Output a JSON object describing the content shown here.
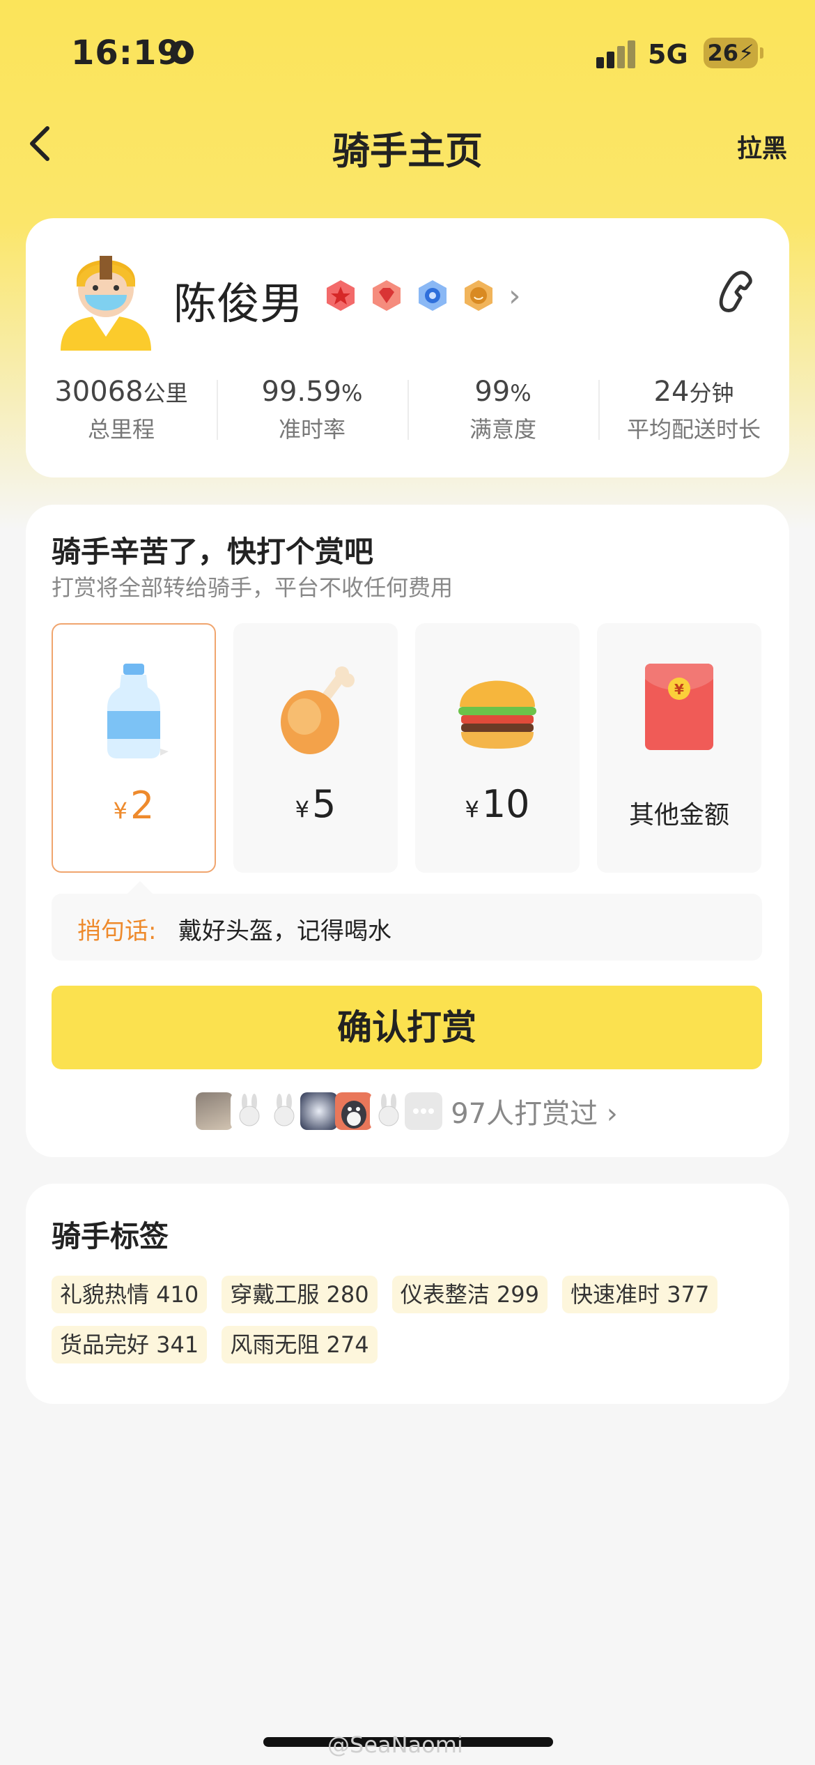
{
  "status_bar": {
    "time": "16:19",
    "network": "5G",
    "battery": "26"
  },
  "nav": {
    "title": "骑手主页",
    "block_label": "拉黑"
  },
  "rider": {
    "name": "陈俊男",
    "medals": [
      "red-star-medal-icon",
      "red-diamond-medal-icon",
      "blue-medal-icon",
      "gold-smile-medal-icon"
    ],
    "stats": [
      {
        "value": "30068",
        "unit": "公里",
        "label": "总里程"
      },
      {
        "value": "99.59",
        "unit": "%",
        "label": "准时率"
      },
      {
        "value": "99",
        "unit": "%",
        "label": "满意度"
      },
      {
        "value": "24",
        "unit": "分钟",
        "label": "平均配送时长"
      }
    ]
  },
  "tip": {
    "title": "骑手辛苦了，快打个赏吧",
    "subtitle": "打赏将全部转给骑手，平台不收任何费用",
    "currency": "¥",
    "options": [
      {
        "icon": "water-bottle-icon",
        "amount": "2",
        "selected": true
      },
      {
        "icon": "chicken-leg-icon",
        "amount": "5",
        "selected": false
      },
      {
        "icon": "burger-icon",
        "amount": "10",
        "selected": false
      },
      {
        "icon": "red-envelope-icon",
        "text": "其他金额",
        "selected": false
      }
    ],
    "message_label": "捎句话:",
    "message_text": "戴好头盔，记得喝水",
    "confirm_label": "确认打赏",
    "tippers_count": "97人打赏过 ›"
  },
  "tags": {
    "title": "骑手标签",
    "items": [
      "礼貌热情 410",
      "穿戴工服 280",
      "仪表整洁 299",
      "快速准时 377",
      "货品完好 341",
      "风雨无阻 274"
    ]
  },
  "watermark": "@SeaNaomi",
  "colors": {
    "accent_yellow": "#fbe14f",
    "selected_orange": "#ee8a2c",
    "tag_bg": "#fdf6dc"
  }
}
